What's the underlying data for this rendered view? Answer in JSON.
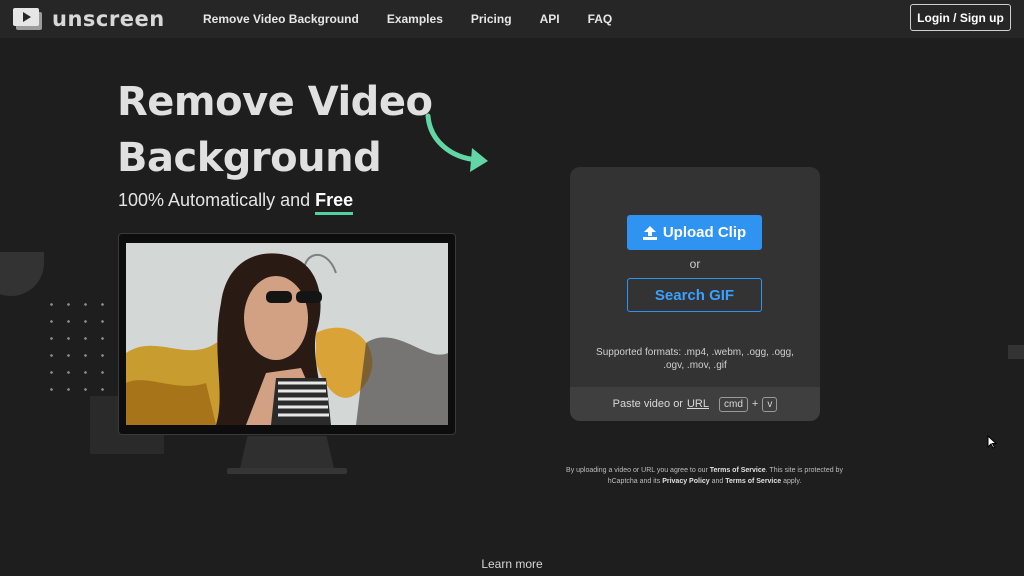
{
  "nav": {
    "logo_text": "unscreen",
    "links": [
      "Remove Video Background",
      "Examples",
      "Pricing",
      "API",
      "FAQ"
    ],
    "login_label": "Login / Sign up"
  },
  "hero": {
    "title_line1": "Remove Video",
    "title_line2": "Background",
    "subtitle_prefix": "100% Automatically and ",
    "subtitle_emphasis": "Free"
  },
  "upload": {
    "upload_label": "Upload Clip",
    "or_label": "or",
    "search_label": "Search GIF",
    "formats_text": "Supported formats: .mp4, .webm, .ogg, .ogg, .ogv, .mov, .gif",
    "paste_prefix": "Paste video or",
    "paste_link": "URL",
    "kbd_cmd": "cmd",
    "kbd_plus": "+",
    "kbd_v": "v"
  },
  "legal": {
    "t1": "By uploading a video or URL you agree to our ",
    "tos": "Terms of Service",
    "t2": ". This site is protected by hCaptcha and its ",
    "privacy": "Privacy Policy",
    "t3": " and ",
    "tos2": "Terms of Service",
    "t4": " apply."
  },
  "learn_more": "Learn more",
  "colors": {
    "accent": "#2f93f2",
    "highlight": "#4fd1a0",
    "background": "#1e1e1e"
  },
  "icons": {
    "logo": "play-icon",
    "upload": "upload-icon",
    "arrow": "curved-arrow-icon",
    "cursor": "cursor-icon"
  }
}
